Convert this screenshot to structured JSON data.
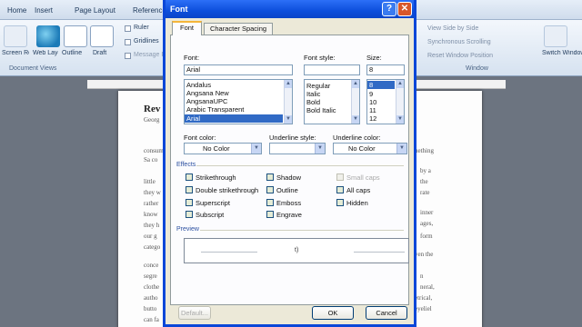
{
  "word": {
    "tabs": [
      "Home",
      "Insert",
      "Page Layout",
      "References"
    ],
    "view_group_buttons": [
      "Screen Reading",
      "Web Layout",
      "Outline",
      "Draft"
    ],
    "group_document_views": "Document Views",
    "show_checks": [
      "Ruler",
      "Gridlines",
      "Message Bar"
    ],
    "window_items": [
      "View Side by Side",
      "Synchronous Scrolling",
      "Reset Window Position"
    ],
    "group_window": "Window",
    "switch_windows": "Switch Windows",
    "page_heading": "Rev",
    "page_lines": [
      "Georg",
      "consume",
      "Sa co",
      "little",
      "they w",
      "rather",
      "know",
      "they h",
      "our g",
      "catego",
      "conce",
      "segre",
      "clothe",
      "autho",
      "butto",
      "can fa"
    ],
    "page_right_lines": [
      "nething",
      "by a",
      "the",
      "rate",
      "inner",
      "ages,",
      "form",
      "ven the",
      "n",
      "neral,",
      "etrical,",
      "eyeliel"
    ]
  },
  "dialog": {
    "title": "Font",
    "tabs": [
      "Font",
      "Character Spacing"
    ],
    "font_label": "Font:",
    "font_value": "Arial",
    "font_list": [
      "Andalus",
      "Angsana New",
      "AngsanaUPC",
      "Arabic Transparent",
      "Arial"
    ],
    "style_label": "Font style:",
    "style_value": "",
    "style_list": [
      "Regular",
      "Italic",
      "Bold",
      "Bold Italic"
    ],
    "size_label": "Size:",
    "size_value": "8",
    "size_list": [
      "8",
      "9",
      "10",
      "11",
      "12"
    ],
    "font_color_label": "Font color:",
    "font_color_value": "No Color",
    "underline_style_label": "Underline style:",
    "underline_style_value": "",
    "underline_color_label": "Underline color:",
    "underline_color_value": "No Color",
    "effects_label": "Effects",
    "effects": {
      "strikethrough": "Strikethrough",
      "double_strikethrough": "Double strikethrough",
      "superscript": "Superscript",
      "subscript": "Subscript",
      "shadow": "Shadow",
      "outline": "Outline",
      "emboss": "Emboss",
      "engrave": "Engrave",
      "small_caps": "Small caps",
      "all_caps": "All caps",
      "hidden": "Hidden"
    },
    "preview_label": "Preview",
    "preview_text": "t)",
    "buttons": {
      "default": "Default...",
      "ok": "OK",
      "cancel": "Cancel"
    }
  },
  "colors": {
    "titlebar": "#0a47d8",
    "dialog_bg": "#ece9d8",
    "selection": "#316ac5",
    "ribbon": "#d6e2f0"
  }
}
